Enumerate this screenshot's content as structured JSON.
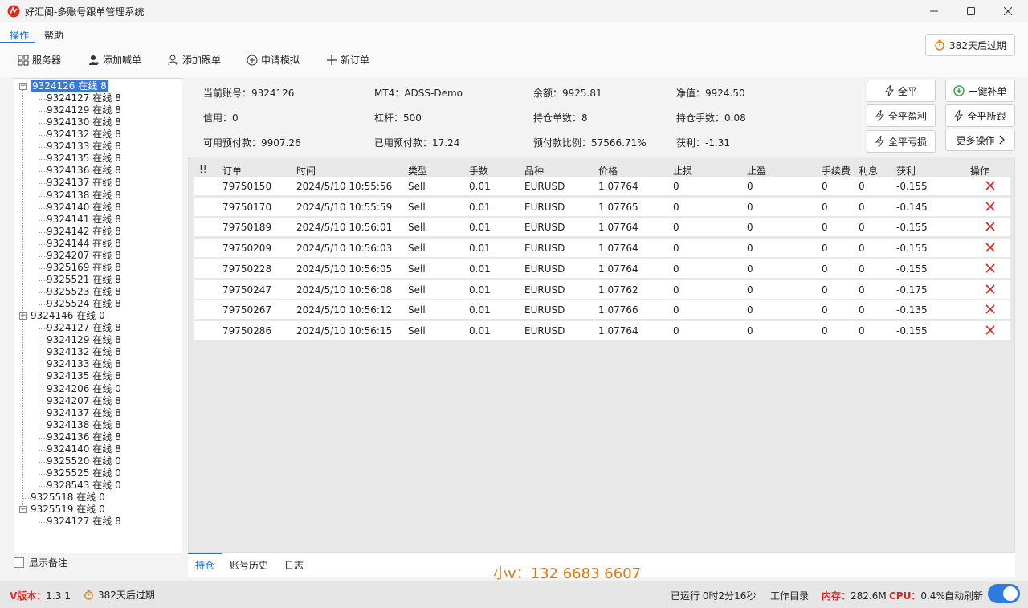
{
  "window": {
    "title": "好汇阁-多账号跟单管理系统"
  },
  "menu": {
    "items": [
      {
        "label": "操作"
      },
      {
        "label": "帮助"
      }
    ]
  },
  "toolbar": {
    "server": "服务器",
    "add_account": "添加喊单",
    "add_follow": "添加跟单",
    "apply_demo": "申请模拟",
    "new_order": "新订单",
    "expire": "382天后过期"
  },
  "tree": {
    "nodes": [
      {
        "label": "9324126 在线 8",
        "level": 0,
        "expanded": true,
        "selected": true
      },
      {
        "label": "9324127 在线 8",
        "level": 1
      },
      {
        "label": "9324129 在线 8",
        "level": 1
      },
      {
        "label": "9324130 在线 8",
        "level": 1
      },
      {
        "label": "9324132 在线 8",
        "level": 1
      },
      {
        "label": "9324133 在线 8",
        "level": 1
      },
      {
        "label": "9324135 在线 8",
        "level": 1
      },
      {
        "label": "9324136 在线 8",
        "level": 1
      },
      {
        "label": "9324137 在线 8",
        "level": 1
      },
      {
        "label": "9324138 在线 8",
        "level": 1
      },
      {
        "label": "9324140 在线 8",
        "level": 1
      },
      {
        "label": "9324141 在线 8",
        "level": 1
      },
      {
        "label": "9324142 在线 8",
        "level": 1
      },
      {
        "label": "9324144 在线 8",
        "level": 1
      },
      {
        "label": "9324207 在线 8",
        "level": 1
      },
      {
        "label": "9325169 在线 8",
        "level": 1
      },
      {
        "label": "9325521 在线 8",
        "level": 1
      },
      {
        "label": "9325523 在线 8",
        "level": 1
      },
      {
        "label": "9325524 在线 8",
        "level": 1
      },
      {
        "label": "9324146 在线 0",
        "level": 0,
        "expanded": true
      },
      {
        "label": "9324127 在线 8",
        "level": 1
      },
      {
        "label": "9324129 在线 8",
        "level": 1
      },
      {
        "label": "9324132 在线 8",
        "level": 1
      },
      {
        "label": "9324133 在线 8",
        "level": 1
      },
      {
        "label": "9324135 在线 8",
        "level": 1
      },
      {
        "label": "9324206 在线 0",
        "level": 1
      },
      {
        "label": "9324207 在线 8",
        "level": 1
      },
      {
        "label": "9324137 在线 8",
        "level": 1
      },
      {
        "label": "9324138 在线 8",
        "level": 1
      },
      {
        "label": "9324136 在线 8",
        "level": 1
      },
      {
        "label": "9324140 在线 8",
        "level": 1
      },
      {
        "label": "9325520 在线 0",
        "level": 1
      },
      {
        "label": "9325525 在线 0",
        "level": 1
      },
      {
        "label": "9328543 在线 0",
        "level": 1
      },
      {
        "label": "9325518 在线 0",
        "level": 0,
        "expanded": false,
        "leaf": true
      },
      {
        "label": "9325519 在线 0",
        "level": 0,
        "expanded": true
      },
      {
        "label": "9324127 在线 8",
        "level": 1
      }
    ],
    "show_notes": "显示备注"
  },
  "info": {
    "account": "当前账号：9324126",
    "mt4": "MT4：ADSS-Demo",
    "balance": "余额：9925.81",
    "equity": "净值：9924.50",
    "credit": "信用：0",
    "leverage": "杠杆：500",
    "positions": "持仓单数：8",
    "lots": "持仓手数：0.08",
    "free_margin": "可用预付款：9907.26",
    "used_margin": "已用预付款：17.24",
    "margin_ratio": "预付款比例：57566.71%",
    "profit": "获利：-1.31"
  },
  "actions": {
    "close_all": "全平",
    "one_click": "一键补单",
    "close_profit": "全平盈利",
    "close_all_follow": "全平所跟",
    "close_loss": "全平亏损",
    "more": "更多操作"
  },
  "grid": {
    "headers": [
      "!!",
      "订单",
      "时间",
      "类型",
      "手数",
      "品种",
      "价格",
      "止损",
      "止盈",
      "手续费",
      "利息",
      "获利",
      "操作"
    ],
    "rows": [
      [
        "79750150",
        "2024/5/10 10:55:56",
        "Sell",
        "0.01",
        "EURUSD",
        "1.07764",
        "0",
        "0",
        "0",
        "0",
        "-0.155"
      ],
      [
        "79750170",
        "2024/5/10 10:55:59",
        "Sell",
        "0.01",
        "EURUSD",
        "1.07765",
        "0",
        "0",
        "0",
        "0",
        "-0.145"
      ],
      [
        "79750189",
        "2024/5/10 10:56:01",
        "Sell",
        "0.01",
        "EURUSD",
        "1.07764",
        "0",
        "0",
        "0",
        "0",
        "-0.155"
      ],
      [
        "79750209",
        "2024/5/10 10:56:03",
        "Sell",
        "0.01",
        "EURUSD",
        "1.07764",
        "0",
        "0",
        "0",
        "0",
        "-0.155"
      ],
      [
        "79750228",
        "2024/5/10 10:56:05",
        "Sell",
        "0.01",
        "EURUSD",
        "1.07764",
        "0",
        "0",
        "0",
        "0",
        "-0.155"
      ],
      [
        "79750247",
        "2024/5/10 10:56:08",
        "Sell",
        "0.01",
        "EURUSD",
        "1.07762",
        "0",
        "0",
        "0",
        "0",
        "-0.175"
      ],
      [
        "79750267",
        "2024/5/10 10:56:12",
        "Sell",
        "0.01",
        "EURUSD",
        "1.07766",
        "0",
        "0",
        "0",
        "0",
        "-0.135"
      ],
      [
        "79750286",
        "2024/5/10 10:56:15",
        "Sell",
        "0.01",
        "EURUSD",
        "1.07764",
        "0",
        "0",
        "0",
        "0",
        "-0.155"
      ]
    ],
    "delete_icon": "close-icon",
    "delete_color": "#e02020"
  },
  "bottom_tabs": [
    {
      "label": "持仓"
    },
    {
      "label": "账号历史"
    },
    {
      "label": "日志"
    }
  ],
  "watermark": "小v：132 6683 6607",
  "status": {
    "version_label": "V版本：",
    "version": "1.3.1",
    "expire": "382天后过期",
    "running": "已运行 0时2分16秒",
    "workdir": "工作目录",
    "mem_label": "内存：",
    "mem": "282.6M",
    "cpu_label": "CPU：",
    "cpu": "0.4%",
    "auto_refresh": "自动刷新",
    "auto_refresh_on": true
  },
  "colors": {
    "accent": "#1d73d6",
    "danger": "#e02020",
    "selection": "#3a77d8"
  }
}
